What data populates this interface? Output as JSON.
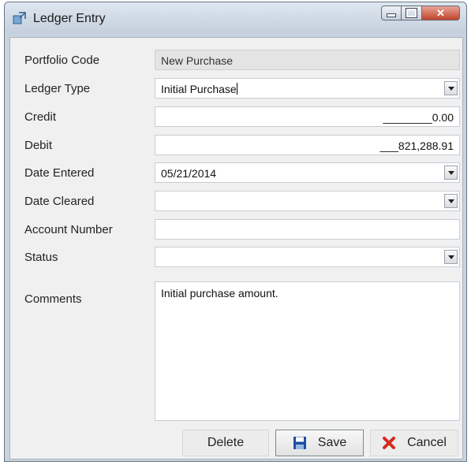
{
  "window": {
    "title": "Ledger Entry"
  },
  "fields": {
    "portfolio_code": {
      "label": "Portfolio Code",
      "value": "New Purchase"
    },
    "ledger_type": {
      "label": "Ledger Type",
      "value": "Initial Purchase"
    },
    "credit": {
      "label": "Credit",
      "value": "________0.00"
    },
    "debit": {
      "label": "Debit",
      "value": "___821,288.91"
    },
    "date_entered": {
      "label": "Date Entered",
      "value": "05/21/2014"
    },
    "date_cleared": {
      "label": "Date Cleared",
      "value": ""
    },
    "account_number": {
      "label": "Account Number",
      "value": ""
    },
    "status": {
      "label": "Status",
      "value": ""
    },
    "comments": {
      "label": "Comments",
      "value": "Initial purchase amount."
    }
  },
  "buttons": {
    "delete": "Delete",
    "save": "Save",
    "cancel": "Cancel"
  },
  "icons": {
    "app": "ledger-app-icon",
    "save": "floppy-disk-icon",
    "cancel": "red-x-icon",
    "dropdown": "chevron-down-icon"
  },
  "colors": {
    "save_icon": "#1f4fa3",
    "cancel_icon": "#d62b1f"
  }
}
